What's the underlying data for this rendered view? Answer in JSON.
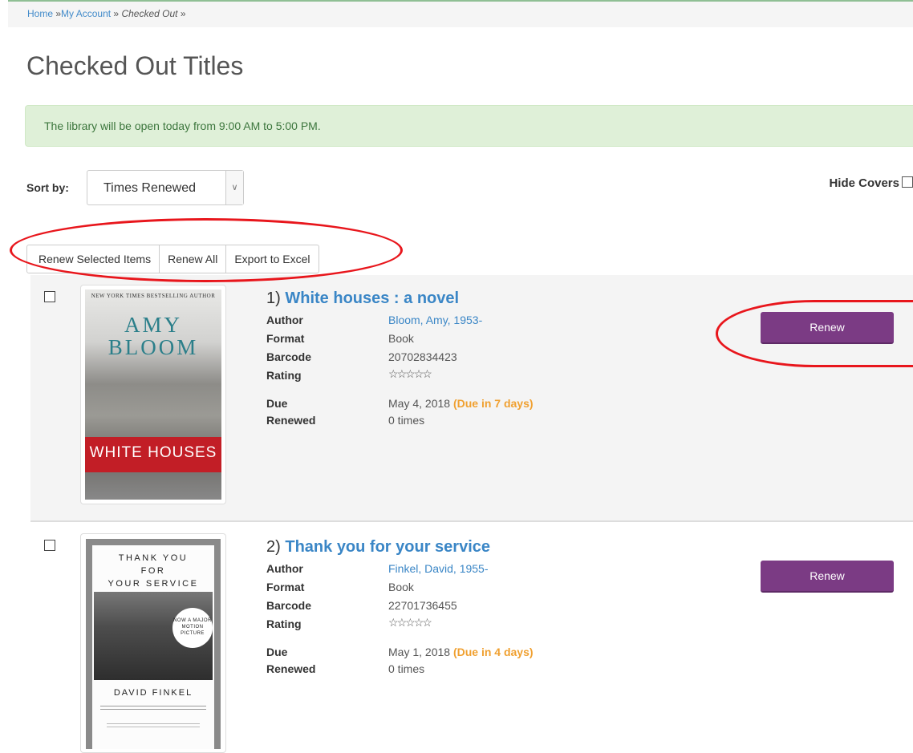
{
  "breadcrumb": {
    "home": "Home",
    "sep1": "»",
    "account": "My Account",
    "sep2": "»",
    "current": "Checked Out",
    "sep3": "»"
  },
  "page_title": "Checked Out Titles",
  "alert": {
    "message": "The library will be open today from 9:00 AM to 5:00 PM.",
    "color": "#dff0d8"
  },
  "sort": {
    "label": "Sort by:",
    "selected": "Times Renewed"
  },
  "hide_covers_label": "Hide Covers",
  "actions": {
    "renew_selected": "Renew Selected Items",
    "renew_all": "Renew All",
    "export": "Export to Excel"
  },
  "field_labels": {
    "author": "Author",
    "format": "Format",
    "barcode": "Barcode",
    "rating": "Rating",
    "due": "Due",
    "renewed": "Renewed"
  },
  "items": [
    {
      "number": "1)",
      "title": "White houses : a novel",
      "author": "Bloom, Amy, 1953-",
      "format": "Book",
      "barcode": "20702834423",
      "rating_stars": 0,
      "due_date": "May 4, 2018",
      "due_note": "(Due in 7 days)",
      "renewed": "0 times",
      "renew_label": "Renew",
      "cover": {
        "tagline": "NEW YORK TIMES BESTSELLING AUTHOR",
        "author_line1": "AMY",
        "author_line2": "BLOOM",
        "title": "WHITE HOUSES"
      }
    },
    {
      "number": "2)",
      "title": "Thank you for your service",
      "author": "Finkel, David, 1955-",
      "format": "Book",
      "barcode": "22701736455",
      "rating_stars": 0,
      "due_date": "May 1, 2018",
      "due_note": "(Due in 4 days)",
      "renewed": "0 times",
      "renew_label": "Renew",
      "cover": {
        "line1": "THANK YOU",
        "line2": "FOR",
        "line3": "YOUR SERVICE",
        "badge": "NOW A MAJOR MOTION PICTURE",
        "author": "DAVID FINKEL"
      }
    }
  ],
  "colors": {
    "accent_link": "#3a86c6",
    "renew_button": "#7b3b84",
    "due_warning": "#f0a030",
    "annotation": "#e8161c"
  }
}
